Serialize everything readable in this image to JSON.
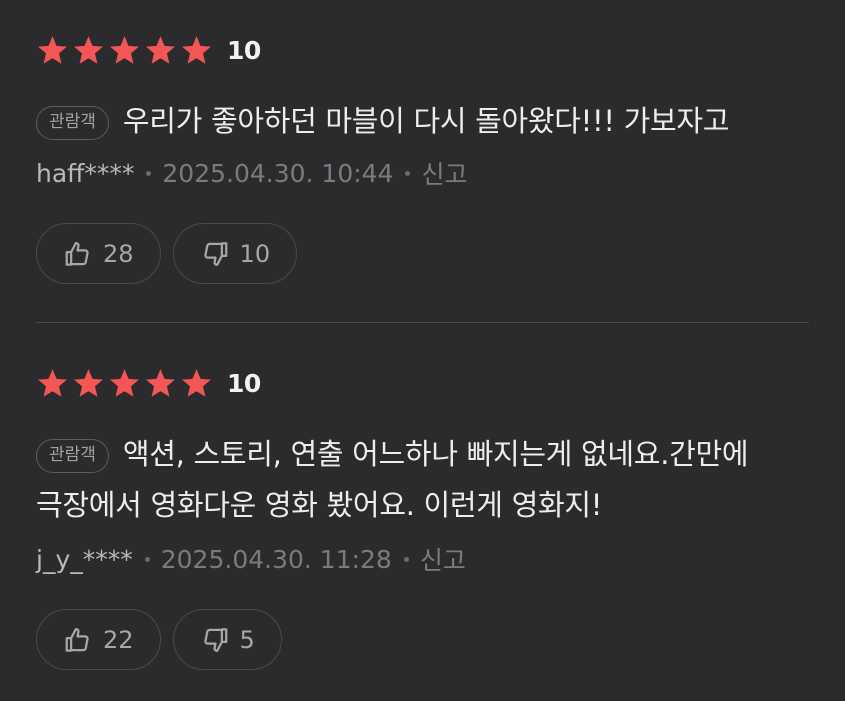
{
  "theme": {
    "background": "#2b2b2d",
    "star_color": "#f45555",
    "text_primary": "#ececec",
    "text_muted": "#7b7b7e"
  },
  "reviews": [
    {
      "stars": 5,
      "score": "10",
      "badge": "관람객",
      "text": "우리가 좋아하던 마블이 다시 돌아왔다!!! 가보자고",
      "user": "haff****",
      "datetime": "2025.04.30. 10:44",
      "report_label": "신고",
      "likes": "28",
      "dislikes": "10"
    },
    {
      "stars": 5,
      "score": "10",
      "badge": "관람객",
      "text": "액션, 스토리, 연출 어느하나 빠지는게 없네요.간만에 극장에서 영화다운 영화 봤어요. 이런게 영화지!",
      "user": "j_y_****",
      "datetime": "2025.04.30. 11:28",
      "report_label": "신고",
      "likes": "22",
      "dislikes": "5"
    }
  ],
  "icons": {
    "star": "star-icon",
    "like": "thumbs-up-icon",
    "dislike": "thumbs-down-icon"
  }
}
